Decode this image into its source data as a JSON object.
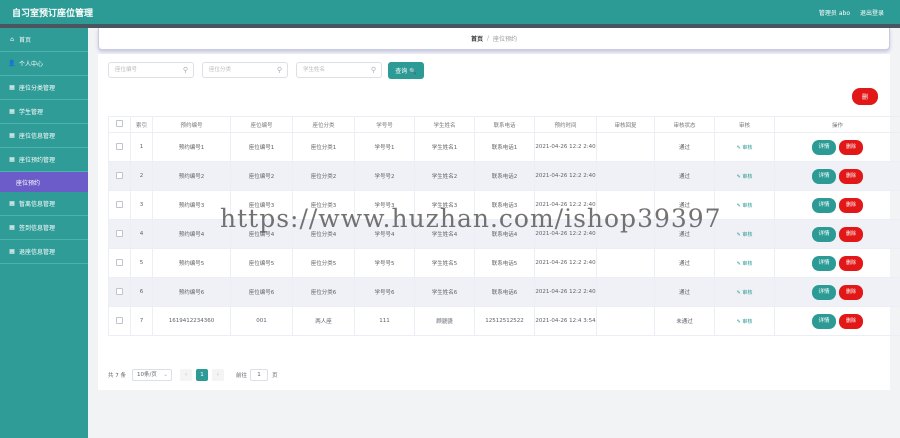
{
  "topbar": {
    "title": "自习室预订座位管理",
    "admin": "管理员 abo",
    "logout": "退出登录"
  },
  "sidebar": {
    "items": [
      {
        "icon": "⌂",
        "label": "首页"
      },
      {
        "icon": "👤",
        "label": "个人中心"
      },
      {
        "icon": "▦",
        "label": "座位分类管理"
      },
      {
        "icon": "▦",
        "label": "学生管理"
      },
      {
        "icon": "▦",
        "label": "座位信息管理"
      },
      {
        "icon": "▦",
        "label": "座位预约管理"
      }
    ],
    "sub_item": "座位预约",
    "items2": [
      {
        "icon": "▦",
        "label": "暂离信息管理"
      },
      {
        "icon": "▦",
        "label": "签到信息管理"
      },
      {
        "icon": "▦",
        "label": "退座信息管理"
      }
    ]
  },
  "breadcrumb": {
    "home": "首页",
    "sep": "/",
    "current": "座位预约"
  },
  "search": {
    "f1_placeholder": "座位编号",
    "f2_placeholder": "座位分类",
    "f3_placeholder": "学生姓名",
    "button": "查询 🔍",
    "icon": "⚲"
  },
  "delete_top": "删",
  "table": {
    "headers": [
      "",
      "索引",
      "预约编号",
      "座位编号",
      "座位分类",
      "学号号",
      "学生姓名",
      "联系电话",
      "预约时间",
      "审核回复",
      "审核状态",
      "审核",
      "操作"
    ],
    "rows": [
      {
        "idx": "1",
        "no": "预约编号1",
        "seat": "座位编号1",
        "cat": "座位分类1",
        "sid": "学号号1",
        "name": "学生姓名1",
        "phone": "联系电话1",
        "time": "2021-04-26 12:2 2:40",
        "reply": "",
        "status": "通过",
        "review": "✎ 审核",
        "detail": "详情",
        "del": "删除"
      },
      {
        "idx": "2",
        "no": "预约编号2",
        "seat": "座位编号2",
        "cat": "座位分类2",
        "sid": "学号号2",
        "name": "学生姓名2",
        "phone": "联系电话2",
        "time": "2021-04-26 12:2 2:40",
        "reply": "",
        "status": "通过",
        "review": "✎ 审核",
        "detail": "详情",
        "del": "删除"
      },
      {
        "idx": "3",
        "no": "预约编号3",
        "seat": "座位编号3",
        "cat": "座位分类3",
        "sid": "学号号3",
        "name": "学生姓名3",
        "phone": "联系电话3",
        "time": "2021-04-26 12:2 2:40",
        "reply": "",
        "status": "通过",
        "review": "✎ 审核",
        "detail": "详情",
        "del": "删除"
      },
      {
        "idx": "4",
        "no": "预约编号4",
        "seat": "座位编号4",
        "cat": "座位分类4",
        "sid": "学号号4",
        "name": "学生姓名4",
        "phone": "联系电话4",
        "time": "2021-04-26 12:2 2:40",
        "reply": "",
        "status": "通过",
        "review": "✎ 审核",
        "detail": "详情",
        "del": "删除"
      },
      {
        "idx": "5",
        "no": "预约编号5",
        "seat": "座位编号5",
        "cat": "座位分类5",
        "sid": "学号号5",
        "name": "学生姓名5",
        "phone": "联系电话5",
        "time": "2021-04-26 12:2 2:40",
        "reply": "",
        "status": "通过",
        "review": "✎ 审核",
        "detail": "详情",
        "del": "删除"
      },
      {
        "idx": "6",
        "no": "预约编号6",
        "seat": "座位编号6",
        "cat": "座位分类6",
        "sid": "学号号6",
        "name": "学生姓名6",
        "phone": "联系电话6",
        "time": "2021-04-26 12:2 2:40",
        "reply": "",
        "status": "通过",
        "review": "✎ 审核",
        "detail": "详情",
        "del": "删除"
      },
      {
        "idx": "7",
        "no": "1619412234360",
        "seat": "001",
        "cat": "两人座",
        "sid": "111",
        "name": "顾骁骁",
        "phone": "12512512522",
        "time": "2021-04-26 12:4 3:54",
        "reply": "",
        "status": "未通过",
        "review": "✎ 审核",
        "detail": "详情",
        "del": "删除"
      }
    ]
  },
  "pager": {
    "total": "共 7 条",
    "size": "10条/页",
    "prev": "‹",
    "page": "1",
    "next": "›",
    "goto": "前往",
    "input": "1",
    "unit": "页",
    "dropdown": "⌄"
  },
  "watermark": "https://www.huzhan.com/ishop39397",
  "colors": {
    "primary": "#2d9b95",
    "danger": "#e21717",
    "submenu": "#6b5cc9"
  }
}
